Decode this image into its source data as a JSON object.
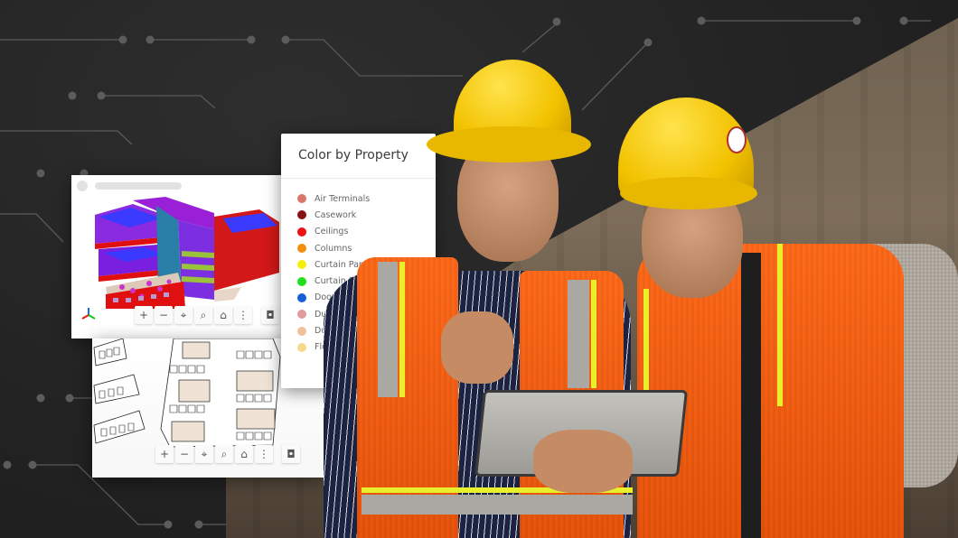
{
  "legend": {
    "title": "Color by Property",
    "items": [
      {
        "label": "Air Terminals",
        "color": "#d9776b"
      },
      {
        "label": "Casework",
        "color": "#8b0f10"
      },
      {
        "label": "Ceilings",
        "color": "#ef1010"
      },
      {
        "label": "Columns",
        "color": "#f0900e"
      },
      {
        "label": "Curtain Panels",
        "color": "#f5ef0a"
      },
      {
        "label": "Curtain S",
        "color": "#1fe01f"
      },
      {
        "label": "Doors",
        "color": "#1560d6"
      },
      {
        "label": "Duct A",
        "color": "#e39a9a"
      },
      {
        "label": "Ducts",
        "color": "#efc29c"
      },
      {
        "label": "Flex D",
        "color": "#f7d98a"
      }
    ]
  },
  "viewer3d": {
    "toolbar": [
      {
        "icon": "zoom-in-icon",
        "glyph": "+"
      },
      {
        "icon": "zoom-out-icon",
        "glyph": "−"
      },
      {
        "icon": "pan-icon",
        "glyph": "⌖"
      },
      {
        "icon": "zoom-window-icon",
        "glyph": "⌕"
      },
      {
        "icon": "home-icon",
        "glyph": "⌂"
      },
      {
        "icon": "more-icon",
        "glyph": "⋮"
      },
      {
        "icon": "camera-icon",
        "glyph": "◘"
      }
    ]
  },
  "viewer2d": {
    "toolbar": [
      {
        "icon": "zoom-in-icon",
        "glyph": "+"
      },
      {
        "icon": "zoom-out-icon",
        "glyph": "−"
      },
      {
        "icon": "pan-icon",
        "glyph": "⌖"
      },
      {
        "icon": "zoom-window-icon",
        "glyph": "⌕"
      },
      {
        "icon": "home-icon",
        "glyph": "⌂"
      },
      {
        "icon": "more-icon",
        "glyph": "⋮"
      },
      {
        "icon": "camera-icon",
        "glyph": "◘"
      }
    ]
  },
  "colors": {
    "background": "#262626",
    "circuit_line": "#5a5a5a",
    "helmet": "#f2c200",
    "vest": "#ff6a1a"
  }
}
